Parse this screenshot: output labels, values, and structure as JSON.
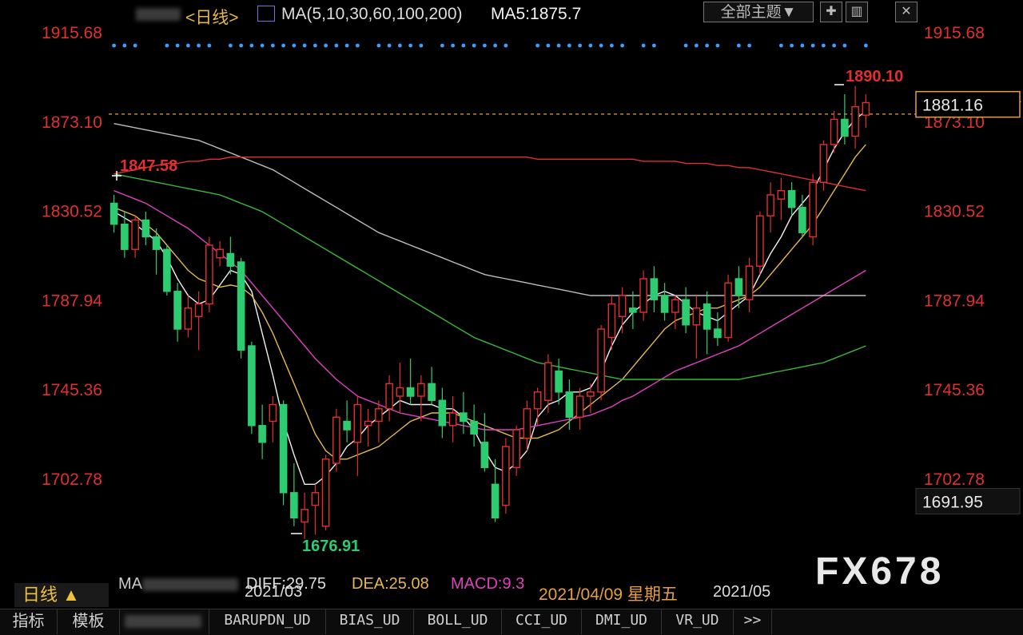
{
  "header": {
    "period_label": "<日线>",
    "ma_label": "MA(5,10,30,60,100,200)",
    "ma5_label": "MA5:1875.7",
    "theme_button": "全部主题▼"
  },
  "chart_data": {
    "type": "candlestick",
    "y_axis_ticks": [
      "1915.68",
      "1873.10",
      "1830.52",
      "1787.94",
      "1745.36",
      "1702.78"
    ],
    "ylim": [
      1660,
      1925
    ],
    "last_price": "1881.16",
    "low_marker": "1691.95",
    "annotations": {
      "high": "1890.10",
      "low": "1676.91",
      "start": "1847.58"
    },
    "x_labels": [
      "2021/03",
      "2021/05"
    ],
    "selected_date": "2021/04/09 星期五",
    "candles": [
      [
        1834,
        1838,
        1820,
        1824
      ],
      [
        1824,
        1830,
        1808,
        1812
      ],
      [
        1812,
        1828,
        1808,
        1826
      ],
      [
        1826,
        1830,
        1814,
        1818
      ],
      [
        1818,
        1822,
        1800,
        1812
      ],
      [
        1812,
        1814,
        1790,
        1792
      ],
      [
        1792,
        1796,
        1768,
        1774
      ],
      [
        1774,
        1790,
        1770,
        1784
      ],
      [
        1780,
        1792,
        1764,
        1786
      ],
      [
        1786,
        1818,
        1782,
        1814
      ],
      [
        1808,
        1816,
        1804,
        1812
      ],
      [
        1810,
        1818,
        1800,
        1804
      ],
      [
        1806,
        1808,
        1760,
        1764
      ],
      [
        1766,
        1768,
        1724,
        1728
      ],
      [
        1728,
        1738,
        1712,
        1720
      ],
      [
        1730,
        1742,
        1720,
        1738
      ],
      [
        1738,
        1740,
        1690,
        1696
      ],
      [
        1696,
        1710,
        1680,
        1684
      ],
      [
        1682,
        1696,
        1674,
        1688
      ],
      [
        1690,
        1700,
        1676,
        1696
      ],
      [
        1680,
        1714,
        1678,
        1712
      ],
      [
        1710,
        1736,
        1706,
        1732
      ],
      [
        1730,
        1740,
        1720,
        1726
      ],
      [
        1720,
        1742,
        1704,
        1738
      ],
      [
        1728,
        1736,
        1718,
        1730
      ],
      [
        1730,
        1740,
        1720,
        1736
      ],
      [
        1736,
        1752,
        1730,
        1748
      ],
      [
        1742,
        1758,
        1734,
        1746
      ],
      [
        1746,
        1760,
        1738,
        1742
      ],
      [
        1742,
        1752,
        1730,
        1748
      ],
      [
        1748,
        1756,
        1738,
        1740
      ],
      [
        1740,
        1746,
        1722,
        1728
      ],
      [
        1728,
        1742,
        1720,
        1734
      ],
      [
        1734,
        1744,
        1724,
        1730
      ],
      [
        1730,
        1738,
        1718,
        1724
      ],
      [
        1720,
        1734,
        1706,
        1708
      ],
      [
        1700,
        1712,
        1682,
        1684
      ],
      [
        1690,
        1722,
        1686,
        1718
      ],
      [
        1708,
        1728,
        1704,
        1726
      ],
      [
        1722,
        1740,
        1716,
        1736
      ],
      [
        1736,
        1746,
        1728,
        1744
      ],
      [
        1740,
        1762,
        1734,
        1758
      ],
      [
        1754,
        1760,
        1738,
        1744
      ],
      [
        1744,
        1750,
        1726,
        1732
      ],
      [
        1732,
        1746,
        1726,
        1742
      ],
      [
        1742,
        1748,
        1734,
        1744
      ],
      [
        1744,
        1776,
        1740,
        1774
      ],
      [
        1770,
        1790,
        1764,
        1786
      ],
      [
        1780,
        1794,
        1772,
        1790
      ],
      [
        1784,
        1792,
        1774,
        1782
      ],
      [
        1782,
        1802,
        1778,
        1798
      ],
      [
        1798,
        1804,
        1782,
        1788
      ],
      [
        1790,
        1796,
        1778,
        1782
      ],
      [
        1782,
        1790,
        1774,
        1788
      ],
      [
        1788,
        1794,
        1772,
        1776
      ],
      [
        1776,
        1790,
        1760,
        1784
      ],
      [
        1786,
        1792,
        1762,
        1774
      ],
      [
        1774,
        1782,
        1766,
        1770
      ],
      [
        1770,
        1800,
        1768,
        1796
      ],
      [
        1798,
        1804,
        1784,
        1790
      ],
      [
        1788,
        1808,
        1782,
        1804
      ],
      [
        1804,
        1830,
        1800,
        1828
      ],
      [
        1828,
        1844,
        1820,
        1838
      ],
      [
        1836,
        1846,
        1826,
        1840
      ],
      [
        1840,
        1844,
        1828,
        1832
      ],
      [
        1832,
        1838,
        1818,
        1820
      ],
      [
        1818,
        1848,
        1814,
        1844
      ],
      [
        1844,
        1864,
        1840,
        1862
      ],
      [
        1862,
        1878,
        1858,
        1874
      ],
      [
        1874,
        1886,
        1862,
        1866
      ],
      [
        1866,
        1890,
        1860,
        1880
      ],
      [
        1876,
        1886,
        1870,
        1882
      ]
    ],
    "ma_lines": [
      {
        "name": "MA5",
        "color": "#f0f0f0",
        "values": [
          1830,
          1827,
          1824,
          1820,
          1816,
          1808,
          1798,
          1790,
          1786,
          1788,
          1795,
          1802,
          1800,
          1792,
          1772,
          1752,
          1730,
          1714,
          1700,
          1700,
          1704,
          1710,
          1718,
          1722,
          1728,
          1732,
          1736,
          1740,
          1738,
          1738,
          1738,
          1736,
          1736,
          1732,
          1726,
          1716,
          1708,
          1706,
          1710,
          1716,
          1732,
          1738,
          1740,
          1744,
          1744,
          1746,
          1754,
          1766,
          1776,
          1782,
          1786,
          1790,
          1792,
          1790,
          1786,
          1782,
          1780,
          1778,
          1782,
          1786,
          1790,
          1800,
          1810,
          1818,
          1828,
          1834,
          1840,
          1850,
          1860,
          1868,
          1874,
          1878
        ]
      },
      {
        "name": "MA10",
        "color": "#e6b84a",
        "values": [
          1832,
          1830,
          1828,
          1824,
          1820,
          1814,
          1808,
          1802,
          1798,
          1796,
          1794,
          1795,
          1794,
          1790,
          1782,
          1772,
          1760,
          1748,
          1736,
          1724,
          1716,
          1712,
          1712,
          1714,
          1716,
          1718,
          1722,
          1726,
          1730,
          1732,
          1734,
          1734,
          1734,
          1732,
          1730,
          1728,
          1726,
          1724,
          1722,
          1722,
          1722,
          1724,
          1726,
          1730,
          1734,
          1738,
          1742,
          1746,
          1750,
          1756,
          1762,
          1768,
          1774,
          1778,
          1780,
          1782,
          1784,
          1784,
          1786,
          1788,
          1790,
          1794,
          1800,
          1806,
          1812,
          1818,
          1824,
          1832,
          1840,
          1848,
          1856,
          1862
        ]
      },
      {
        "name": "MA30",
        "color": "#e040c0",
        "values": [
          1840,
          1838,
          1836,
          1834,
          1831,
          1828,
          1825,
          1822,
          1818,
          1814,
          1810,
          1806,
          1802,
          1796,
          1790,
          1784,
          1778,
          1772,
          1766,
          1760,
          1755,
          1750,
          1746,
          1742,
          1740,
          1738,
          1736,
          1734,
          1733,
          1732,
          1731,
          1730,
          1729,
          1728,
          1727,
          1726,
          1726,
          1726,
          1726,
          1727,
          1728,
          1729,
          1730,
          1731,
          1732,
          1733,
          1735,
          1737,
          1740,
          1742,
          1745,
          1748,
          1751,
          1754,
          1756,
          1758,
          1760,
          1762,
          1764,
          1766,
          1769,
          1772,
          1775,
          1778,
          1781,
          1784,
          1787,
          1790,
          1793,
          1796,
          1799,
          1802
        ]
      },
      {
        "name": "MA60",
        "color": "#3ab83a",
        "values": [
          1848,
          1847,
          1846,
          1845,
          1844,
          1843,
          1842,
          1841,
          1840,
          1839,
          1838,
          1836,
          1834,
          1832,
          1830,
          1827,
          1824,
          1821,
          1818,
          1815,
          1812,
          1809,
          1806,
          1803,
          1800,
          1797,
          1794,
          1791,
          1788,
          1785,
          1782,
          1779,
          1776,
          1773,
          1770,
          1768,
          1766,
          1764,
          1762,
          1760,
          1758,
          1757,
          1756,
          1755,
          1754,
          1753,
          1752,
          1751,
          1750,
          1750,
          1750,
          1750,
          1750,
          1750,
          1750,
          1750,
          1750,
          1750,
          1750,
          1750,
          1751,
          1752,
          1753,
          1754,
          1755,
          1756,
          1757,
          1758,
          1760,
          1762,
          1764,
          1766
        ]
      },
      {
        "name": "MA100",
        "color": "#bdbdbd",
        "values": [
          1872,
          1871,
          1870,
          1869,
          1868,
          1867,
          1866,
          1865,
          1864,
          1862,
          1860,
          1858,
          1856,
          1854,
          1852,
          1850,
          1847,
          1844,
          1841,
          1838,
          1835,
          1832,
          1829,
          1826,
          1823,
          1820,
          1818,
          1816,
          1814,
          1812,
          1810,
          1808,
          1806,
          1804,
          1802,
          1800,
          1799,
          1798,
          1797,
          1796,
          1795,
          1794,
          1793,
          1792,
          1791,
          1790,
          1790,
          1790,
          1790,
          1790,
          1790,
          1790,
          1790,
          1790,
          1790,
          1790,
          1790,
          1790,
          1790,
          1790,
          1790,
          1790,
          1790,
          1790,
          1790,
          1790,
          1790,
          1790,
          1790,
          1790,
          1790,
          1790
        ]
      },
      {
        "name": "MA200",
        "color": "#e03030",
        "values": [
          1848,
          1849,
          1850,
          1851,
          1852,
          1853,
          1853,
          1854,
          1854,
          1855,
          1855,
          1856,
          1856,
          1856,
          1856,
          1856,
          1856,
          1856,
          1856,
          1856,
          1856,
          1856,
          1856,
          1856,
          1856,
          1856,
          1856,
          1856,
          1856,
          1856,
          1856,
          1856,
          1856,
          1856,
          1856,
          1856,
          1856,
          1856,
          1856,
          1856,
          1855,
          1855,
          1855,
          1855,
          1855,
          1855,
          1855,
          1855,
          1855,
          1855,
          1854,
          1854,
          1854,
          1854,
          1853,
          1853,
          1853,
          1852,
          1852,
          1851,
          1851,
          1850,
          1849,
          1848,
          1847,
          1846,
          1845,
          1844,
          1843,
          1842,
          1841,
          1840
        ]
      }
    ]
  },
  "indicator": {
    "ma_text": "MA",
    "diff": "DIFF:29.75",
    "dea": "DEA:25.08",
    "macd": "MACD:9.3",
    "period": "日线 ▲"
  },
  "tabs": [
    {
      "label": "指标"
    },
    {
      "label": "模板"
    },
    {
      "label": ""
    },
    {
      "label": "BARUPDN_UD"
    },
    {
      "label": "BIAS_UD"
    },
    {
      "label": "BOLL_UD"
    },
    {
      "label": "CCI_UD"
    },
    {
      "label": "DMI_UD"
    },
    {
      "label": "VR_UD"
    },
    {
      "label": ">>"
    }
  ],
  "watermark": "FX678",
  "colors": {
    "up": "#e03030",
    "down": "#2ecc71",
    "axis_text": "#e03030",
    "price_line": "#e6a040"
  }
}
